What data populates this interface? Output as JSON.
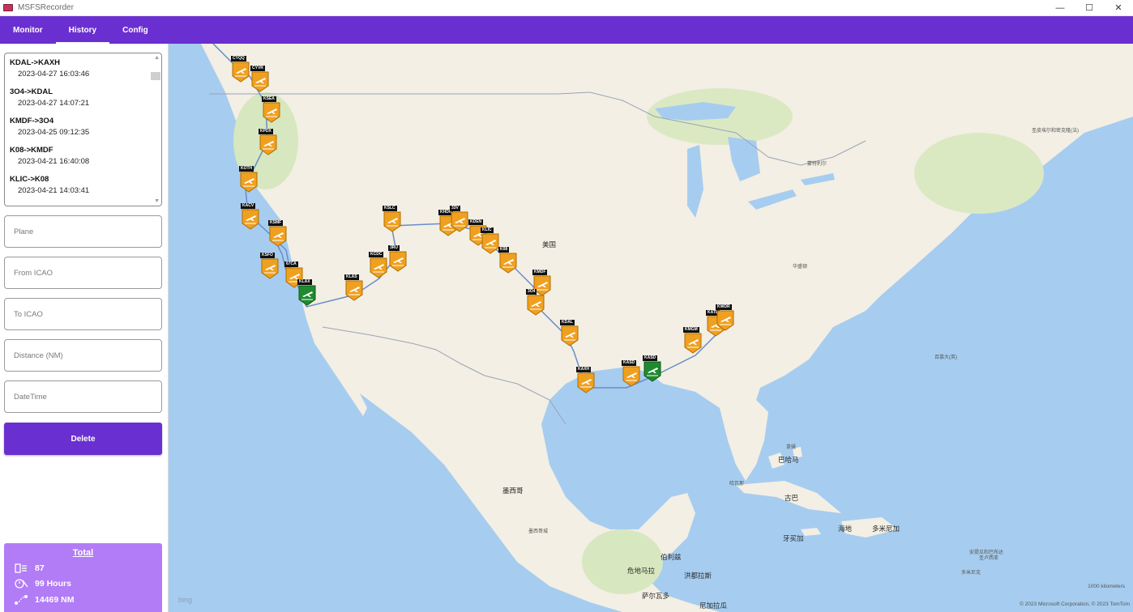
{
  "window": {
    "title": "MSFSRecorder",
    "minimize": "—",
    "maximize": "☐",
    "close": "✕"
  },
  "nav": {
    "tabs": [
      {
        "label": "Monitor",
        "active": false
      },
      {
        "label": "History",
        "active": true
      },
      {
        "label": "Config",
        "active": false
      }
    ]
  },
  "history": {
    "flights": [
      {
        "route": "KDAL->KAXH",
        "date": "2023-04-27 16:03:46"
      },
      {
        "route": "3O4->KDAL",
        "date": "2023-04-27 14:07:21"
      },
      {
        "route": "KMDF->3O4",
        "date": "2023-04-25 09:12:35"
      },
      {
        "route": "K08->KMDF",
        "date": "2023-04-21 16:40:08"
      },
      {
        "route": "KLIC->K08",
        "date": "2023-04-21 14:03:41"
      }
    ]
  },
  "form": {
    "plane_placeholder": "Plane",
    "from_placeholder": "From ICAO",
    "to_placeholder": "To ICAO",
    "distance_placeholder": "Distance (NM)",
    "datetime_placeholder": "DateTime",
    "delete_label": "Delete"
  },
  "total": {
    "title": "Total",
    "flights": "87",
    "hours": "99 Hours",
    "distance": "14469 NM"
  },
  "map": {
    "labels": {
      "usa": "美国",
      "mexico": "墨西哥",
      "mexico_city": "墨西哥城",
      "montreal": "蒙特利尔",
      "washington": "华盛顿",
      "havana": "哈瓦那",
      "cuba": "古巴",
      "jamaica": "牙买加",
      "haiti": "海地",
      "dominican": "多米尼加",
      "belize": "伯利兹",
      "guatemala": "危地马拉",
      "honduras": "洪都拉斯",
      "el_salvador": "萨尔瓦多",
      "nicaragua": "尼加拉瓜",
      "bahamas": "巴哈马",
      "nassau": "拿骚",
      "puerto_rico": "圣卢西亚",
      "st_lucia": "多米尼克",
      "trinidad": "安提瓜和巴布达",
      "bermuda": "百慕大(英)",
      "saint_pierre": "圣皮埃尔和密克隆(法)"
    },
    "bing": "bing",
    "scale": "1000 kilometers",
    "copyright": "© 2023 Microsoft Corporation, © 2023 TomTom"
  },
  "airports": [
    {
      "code": "CYQQ",
      "status": "orange"
    },
    {
      "code": "CYVR",
      "status": "orange"
    },
    {
      "code": "KSEA",
      "status": "orange"
    },
    {
      "code": "KPDX",
      "status": "orange"
    },
    {
      "code": "KOTH",
      "status": "orange"
    },
    {
      "code": "KACV",
      "status": "orange"
    },
    {
      "code": "KSMF",
      "status": "orange"
    },
    {
      "code": "KSFO",
      "status": "orange"
    },
    {
      "code": "67CA",
      "status": "orange"
    },
    {
      "code": "KLAX",
      "status": "green"
    },
    {
      "code": "KLAS",
      "status": "orange"
    },
    {
      "code": "KCDC",
      "status": "orange"
    },
    {
      "code": "3RU",
      "status": "orange"
    },
    {
      "code": "KSLC",
      "status": "orange"
    },
    {
      "code": "KHDN",
      "status": "orange"
    },
    {
      "code": "33V",
      "status": "orange"
    },
    {
      "code": "KDEN",
      "status": "orange"
    },
    {
      "code": "KLIC",
      "status": "orange"
    },
    {
      "code": "K08",
      "status": "orange"
    },
    {
      "code": "KMDF",
      "status": "orange"
    },
    {
      "code": "3O4",
      "status": "orange"
    },
    {
      "code": "KDAL",
      "status": "orange"
    },
    {
      "code": "KAXH",
      "status": "orange"
    },
    {
      "code": "KASD",
      "status": "orange"
    },
    {
      "code": "KASD",
      "status": "green"
    },
    {
      "code": "KMGM",
      "status": "orange"
    },
    {
      "code": "KATL",
      "status": "orange"
    },
    {
      "code": "KWDR",
      "status": "orange"
    }
  ]
}
